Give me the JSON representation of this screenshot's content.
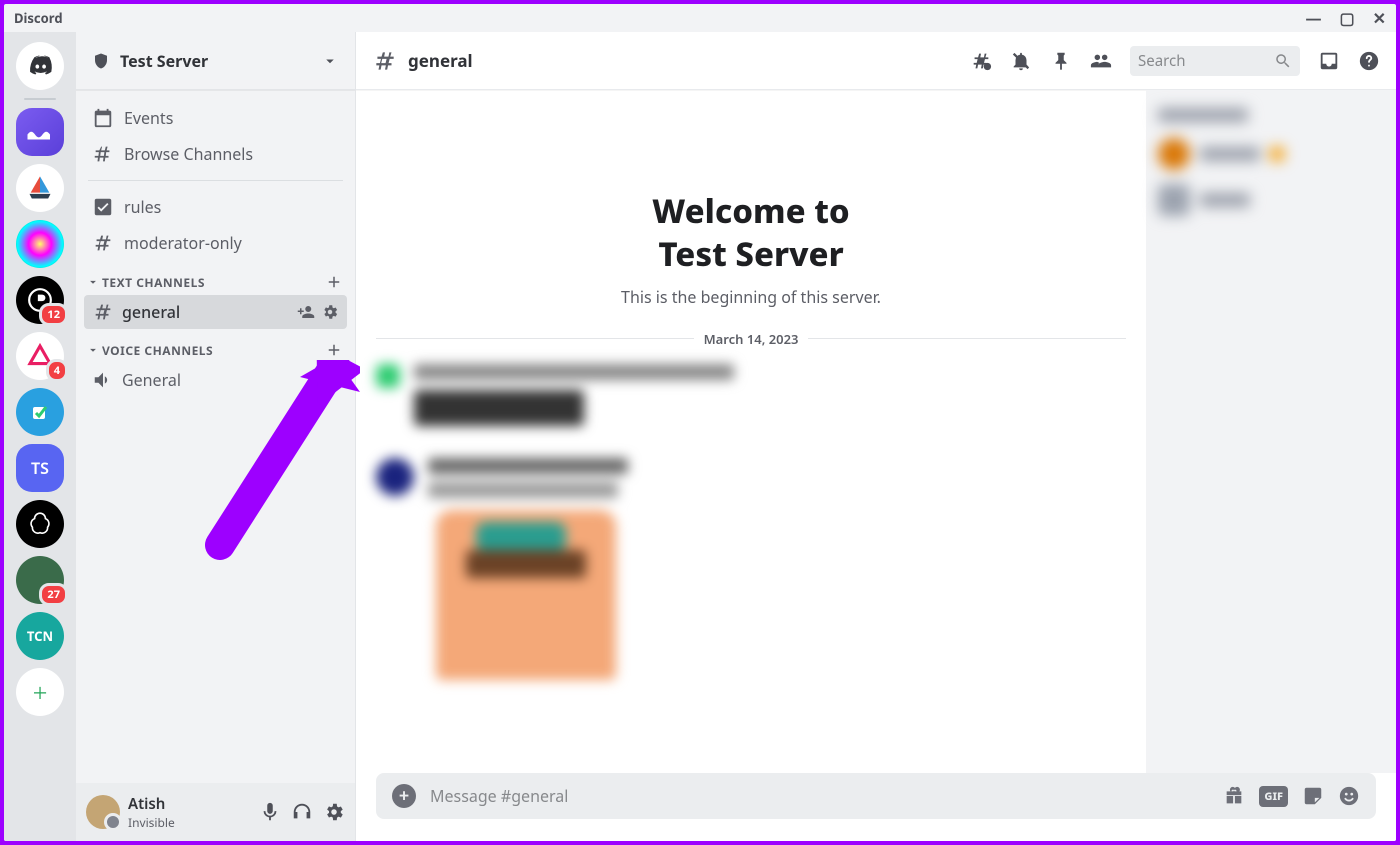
{
  "app_title": "Discord",
  "window_controls": {
    "min": "—",
    "max": "▢",
    "close": "✕"
  },
  "servers": [
    {
      "id": "home",
      "bg": "#fff",
      "letter": "",
      "badge": null
    },
    {
      "id": "s1",
      "bg": "#5865f2",
      "letter": "",
      "badge": null
    },
    {
      "id": "s2",
      "bg": "#fff",
      "letter": "",
      "badge": null
    },
    {
      "id": "s3",
      "bg": "#fff",
      "letter": "",
      "badge": null
    },
    {
      "id": "s4",
      "bg": "#000",
      "letter": "",
      "badge": "12"
    },
    {
      "id": "s5",
      "bg": "#fff",
      "letter": "",
      "badge": "4"
    },
    {
      "id": "s6",
      "bg": "#29a0e0",
      "letter": "",
      "badge": null
    },
    {
      "id": "s7",
      "bg": "#5865f2",
      "letter": "TS",
      "badge": null
    },
    {
      "id": "s8",
      "bg": "#000",
      "letter": "",
      "badge": null
    },
    {
      "id": "s9",
      "bg": "#3a6",
      "letter": "",
      "badge": "27"
    },
    {
      "id": "s10",
      "bg": "#17a79e",
      "letter": "TCN",
      "badge": null
    },
    {
      "id": "add",
      "bg": "#fff",
      "letter": "+",
      "badge": null
    }
  ],
  "server_name": "Test Server",
  "nav": {
    "events": "Events",
    "browse": "Browse Channels",
    "rules": "rules",
    "mod": "moderator-only"
  },
  "categories": {
    "text": "TEXT CHANNELS",
    "voice": "VOICE CHANNELS"
  },
  "channels": {
    "general": "general",
    "voice_general": "General"
  },
  "user": {
    "name": "Atish",
    "status": "Invisible"
  },
  "chat": {
    "channel": "general",
    "welcome_line1": "Welcome to",
    "welcome_line2": "Test Server",
    "welcome_sub": "This is the beginning of this server.",
    "date": "March 14, 2023",
    "input_placeholder": "Message #general",
    "search_placeholder": "Search"
  }
}
